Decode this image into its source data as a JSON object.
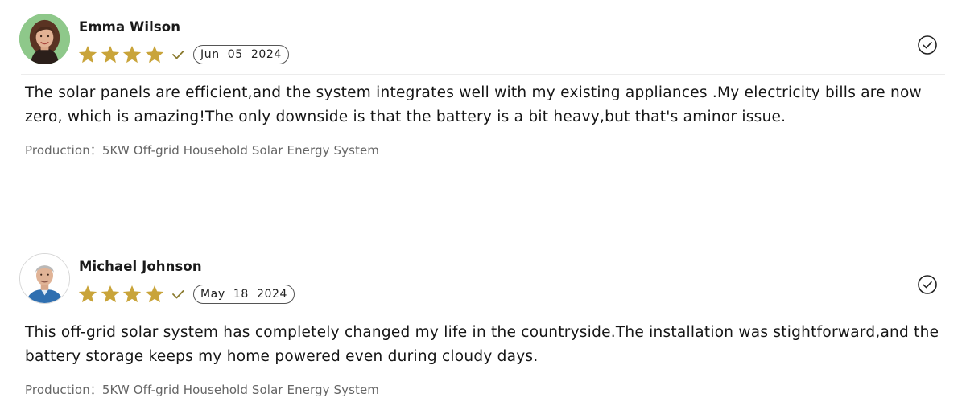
{
  "colors": {
    "star_gold": "#c9a43a",
    "verified_green": "#8a7a2e",
    "text_dark": "#151515",
    "text_muted": "#666666",
    "pill_border": "#555555",
    "divider": "#ececec"
  },
  "icons": {
    "star": "star-icon",
    "verified": "checkmark-icon",
    "status": "check-circle-icon"
  },
  "reviews": [
    {
      "name": "Emma Wilson",
      "rating": 4,
      "date": "Jun  05  2024",
      "text": "The solar panels are efficient,and the system integrates well with my existing appliances .My electricity bills are now zero, which is amazing!The only downside is that the battery is a bit heavy,but that's aminor issue.",
      "product_label": "Production：",
      "product_name": "5KW Off-grid Household Solar Energy System"
    },
    {
      "name": "Michael Johnson",
      "rating": 4,
      "date": "May  18  2024",
      "text": "This off-grid solar system has completely changed my life in the countryside.The installation was stightforward,and the battery storage keeps my home powered even during cloudy days.",
      "product_label": "Production：",
      "product_name": "5KW Off-grid Household Solar Energy System"
    }
  ]
}
